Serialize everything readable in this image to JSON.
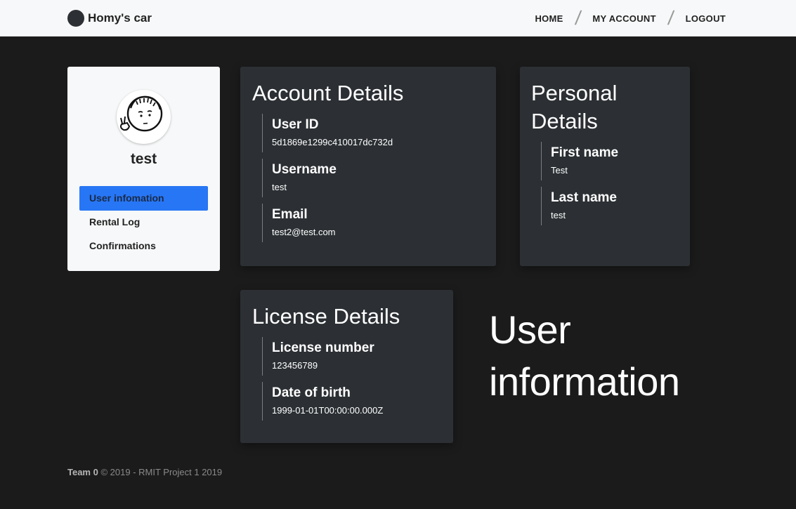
{
  "navbar": {
    "brand": "Homy's car",
    "links": [
      "HOME",
      "MY ACCOUNT",
      "LOGOUT"
    ],
    "separator": "/"
  },
  "sidebar": {
    "username": "test",
    "items": [
      "User infomation",
      "Rental Log",
      "Confirmations"
    ],
    "active_index": 0
  },
  "account_details": {
    "title": "Account Details",
    "fields": [
      {
        "label": "User ID",
        "value": "5d1869e1299c410017dc732d"
      },
      {
        "label": "Username",
        "value": "test"
      },
      {
        "label": "Email",
        "value": "test2@test.com"
      }
    ]
  },
  "personal_details": {
    "title_line1": "Personal",
    "title_line2": "Details",
    "fields": [
      {
        "label": "First name",
        "value": "Test"
      },
      {
        "label": "Last name",
        "value": "test"
      }
    ]
  },
  "license_details": {
    "title": "License Details",
    "fields": [
      {
        "label": "License number",
        "value": "123456789"
      },
      {
        "label": "Date of birth",
        "value": "1999-01-01T00:00:00.000Z"
      }
    ]
  },
  "page_heading": {
    "line1": "User",
    "line2": "information"
  },
  "footer": {
    "team": "Team 0",
    "text": "© 2019 - RMIT Project 1 2019"
  },
  "colors": {
    "page_bg": "#1b1b1b",
    "navbar_bg": "#f7f8f9",
    "card_bg": "#2c3034",
    "active_item": "#2776f5"
  }
}
